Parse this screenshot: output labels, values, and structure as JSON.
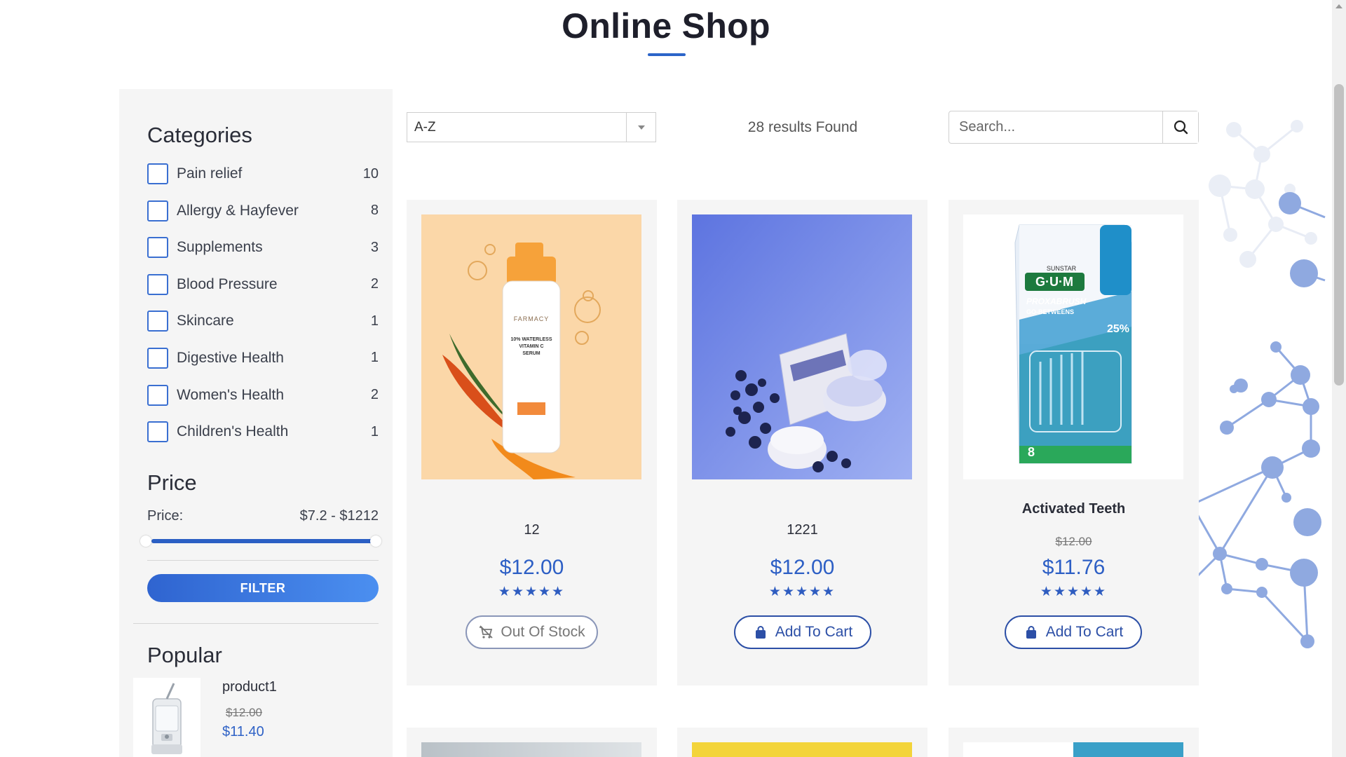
{
  "page": {
    "title": "Online Shop"
  },
  "sidebar": {
    "categories_heading": "Categories",
    "categories": [
      {
        "label": "Pain relief",
        "count": "10"
      },
      {
        "label": "Allergy & Hayfever",
        "count": "8"
      },
      {
        "label": "Supplements",
        "count": "3"
      },
      {
        "label": "Blood Pressure",
        "count": "2"
      },
      {
        "label": "Skincare",
        "count": "1"
      },
      {
        "label": "Digestive Health",
        "count": "1"
      },
      {
        "label": "Women's Health",
        "count": "2"
      },
      {
        "label": "Children's Health",
        "count": "1"
      }
    ],
    "price_heading": "Price",
    "price_label": "Price:",
    "price_range": "$7.2 - $1212",
    "filter_label": "FILTER",
    "popular_heading": "Popular",
    "popular": [
      {
        "name": "product1",
        "old_price": "$12.00",
        "price": "$11.40"
      }
    ]
  },
  "toolbar": {
    "sort_value": "A-Z",
    "results_text": "28 results Found",
    "search_placeholder": "Search..."
  },
  "products": [
    {
      "name": "12",
      "old_price": "",
      "price": "$12.00",
      "stars": "★★★★★",
      "button": "Out Of Stock",
      "in_stock": false
    },
    {
      "name": "1221",
      "old_price": "",
      "price": "$12.00",
      "stars": "★★★★★",
      "button": "Add To Cart",
      "in_stock": true
    },
    {
      "name": "Activated Teeth",
      "old_price": "$12.00",
      "price": "$11.76",
      "stars": "★★★★★",
      "button": "Add To Cart",
      "in_stock": true
    }
  ],
  "product_image_text": {
    "p1_brand": "FARMACY",
    "p1_line1": "10% WATERLESS",
    "p1_line2": "VITAMIN C",
    "p1_line3": "SERUM",
    "p3_brand_top": "SUNSTAR",
    "p3_brand": "G·U·M",
    "p3_line1": "PROXABRUSH",
    "p3_line2": "GO-BETWEENS",
    "p3_badge": "25%",
    "p3_count": "8"
  },
  "colors": {
    "accent": "#2c65c9",
    "price": "#2d5fc5",
    "card_bg": "#f5f5f5"
  }
}
